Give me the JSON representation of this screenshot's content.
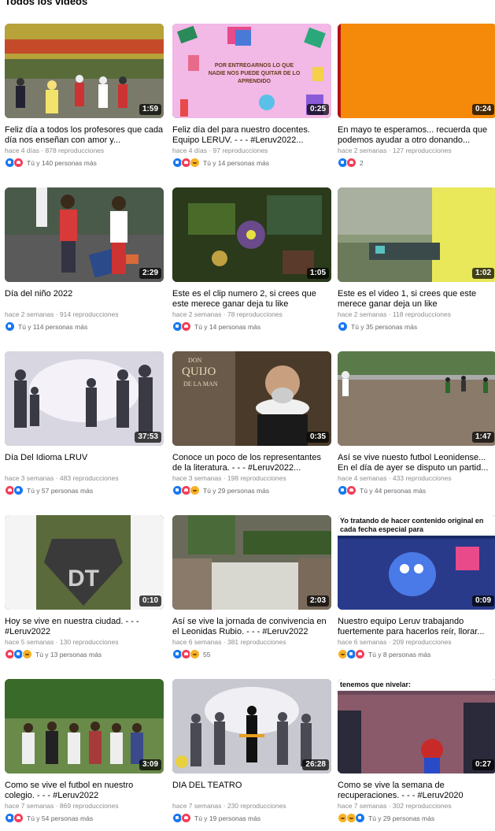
{
  "section": {
    "title": "Todos los videos"
  },
  "videos": [
    {
      "title": "Feliz día a todos los profesores que cada día nos enseñan con amor y...",
      "meta": "hace 4 días · 878 reproducciones",
      "duration": "1:59",
      "reactions_text": "Tú y 140 personas más",
      "reactions": [
        "like",
        "love"
      ]
    },
    {
      "title": "Feliz día del para nuestro docentes. Equipo LERUV. - - - #Leruv2022...",
      "meta": "hace 4 días · 97 reproducciones",
      "duration": "0:25",
      "reactions_text": "Tú y 14 personas más",
      "reactions": [
        "like",
        "love",
        "care"
      ]
    },
    {
      "title": "En mayo te esperamos... recuerda que podemos ayudar a otro donando...",
      "meta": "hace 2 semanas · 127 reproducciones",
      "duration": "0:24",
      "reactions_text": "2",
      "reactions": [
        "like",
        "love"
      ]
    },
    {
      "title": "Día del niño 2022",
      "meta": "hace 2 semanas · 914 reproducciones",
      "duration": "2:29",
      "reactions_text": "Tú y 114 personas más",
      "reactions": [
        "like"
      ]
    },
    {
      "title": "Este es el clip numero 2, si crees que este merece ganar deja tu like",
      "meta": "hace 2 semanas · 78 reproducciones",
      "duration": "1:05",
      "reactions_text": "Tú y 14 personas más",
      "reactions": [
        "like",
        "love"
      ]
    },
    {
      "title": "Este es el video 1, si crees que este merece ganar deja un like",
      "meta": "hace 2 semanas · 118 reproducciones",
      "duration": "1:02",
      "reactions_text": "Tú y 35 personas más",
      "reactions": [
        "like"
      ]
    },
    {
      "title": "Día Del Idioma LRUV",
      "meta": "hace 3 semanas · 483 reproducciones",
      "duration": "37:53",
      "reactions_text": "Tú y 57 personas más",
      "reactions": [
        "love",
        "like"
      ]
    },
    {
      "title": "Conoce un poco de los representantes de la literatura. - - - #Leruv2022...",
      "meta": "hace 3 semanas · 198 reproducciones",
      "duration": "0:35",
      "reactions_text": "Tú y 29 personas más",
      "reactions": [
        "like",
        "love",
        "care"
      ]
    },
    {
      "title": "Así se vive nuesto futbol Leonidense... En el día de ayer se disputo un partid...",
      "meta": "hace 4 semanas · 433 reproducciones",
      "duration": "1:47",
      "reactions_text": "Tú y 44 personas más",
      "reactions": [
        "like",
        "love"
      ]
    },
    {
      "title": "Hoy se vive en nuestra ciudad. - - - #Leruv2022",
      "meta": "hace 5 semanas · 130 reproducciones",
      "duration": "0:10",
      "reactions_text": "Tú y 13 personas más",
      "reactions": [
        "love",
        "like",
        "care"
      ]
    },
    {
      "title": "Así se vive la jornada de convivencia en el Leonidas Rubio. - - - #Leruv2022",
      "meta": "hace 6 semanas · 381 reproducciones",
      "duration": "2:03",
      "reactions_text": "55",
      "reactions": [
        "like",
        "love",
        "care"
      ]
    },
    {
      "title": "Nuestro equipo Leruv trabajando fuertemente para hacerlos reír, llorar...",
      "meta": "hace 6 semanas · 209 reproducciones",
      "duration": "0:09",
      "reactions_text": "Tú y 8 personas más",
      "reactions": [
        "haha",
        "like",
        "love"
      ],
      "banner": "Yo tratando de hacer contenido original en cada fecha especial para"
    },
    {
      "title": "Como se vive el futbol en nuestro colegio. - - - #Leruv2022",
      "meta": "hace 7 semanas · 869 reproducciones",
      "duration": "3:09",
      "reactions_text": "Tú y 54 personas más",
      "reactions": [
        "like",
        "love"
      ]
    },
    {
      "title": "DIA DEL TEATRO",
      "meta": "hace 7 semanas · 230 reproducciones",
      "duration": "26:28",
      "reactions_text": "Tú y 19 personas más",
      "reactions": [
        "like",
        "love"
      ]
    },
    {
      "title": "Como se vive la semana de recuperaciones. - - - #Leruv2020",
      "meta": "hace 7 semanas · 302 reproducciones",
      "duration": "0:27",
      "reactions_text": "Tú y 29 personas más",
      "reactions": [
        "haha",
        "care",
        "like"
      ],
      "banner": "tenemos que nivelar:"
    }
  ]
}
